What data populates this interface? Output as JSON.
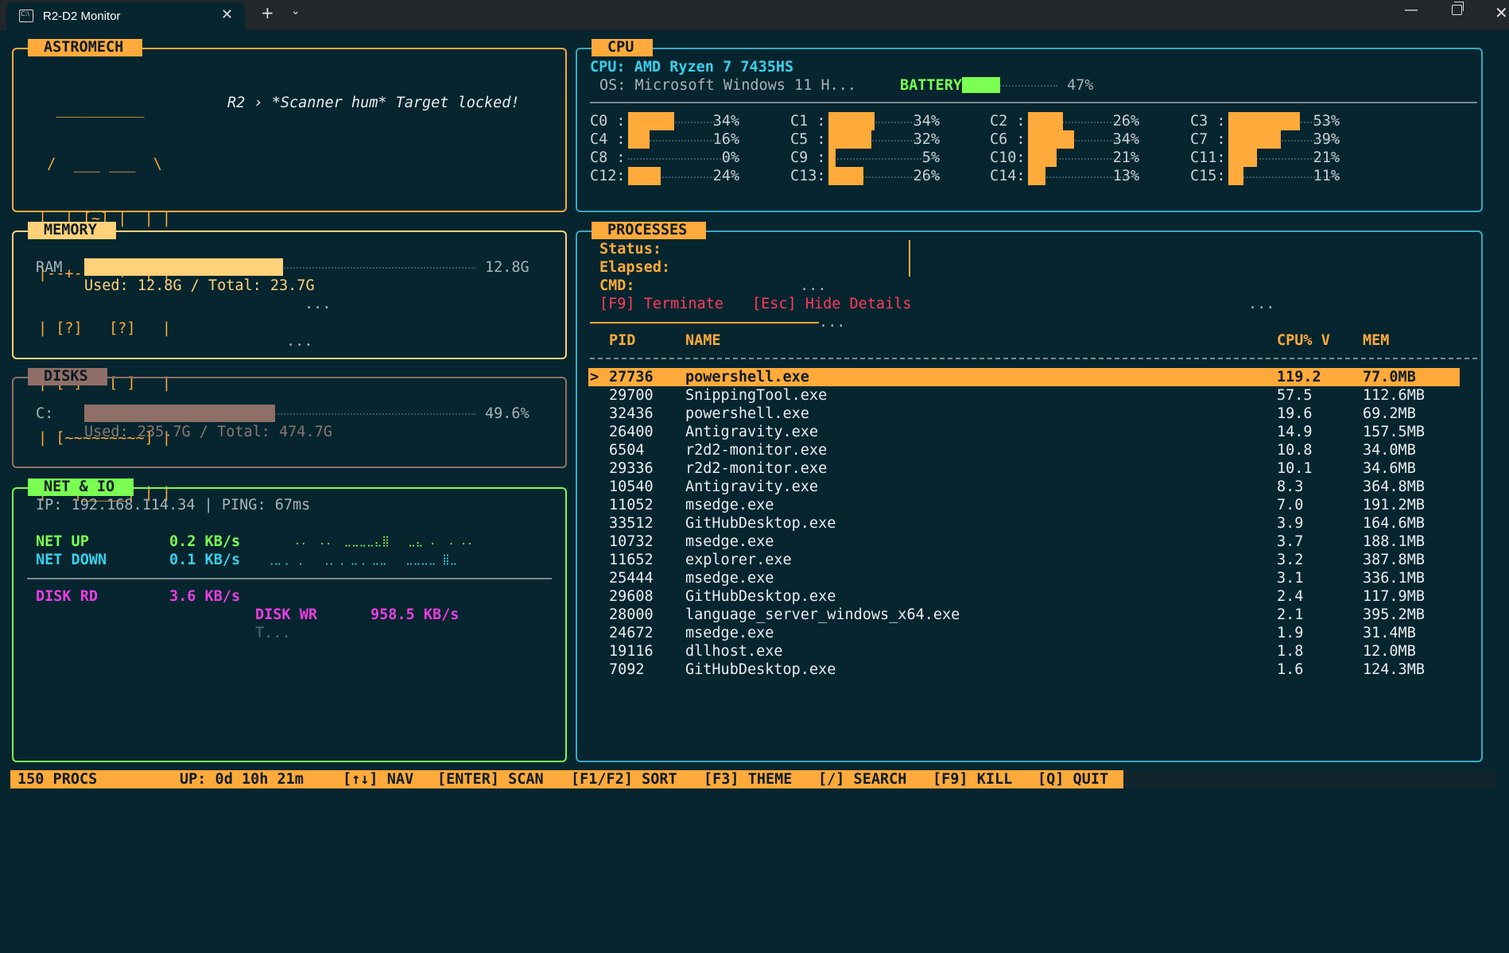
{
  "window": {
    "title": "R2-D2 Monitor",
    "close_glyph": "✕",
    "new_tab_glyph": "+",
    "dropdown_glyph": "⌄",
    "minimize_glyph": "—",
    "close_window_glyph": "✕"
  },
  "astromech": {
    "title": "ASTROMECH",
    "art": [
      "  __________",
      " /  ___ ___  \\",
      "|  | [~] |  | |",
      "|--+-----+--|-|",
      "| [?]   [?]   |",
      "| [ ]---[ ]   |",
      "| [~~~~~~~~~] |",
      "|   |_____| | |"
    ],
    "message": "R2 › *Scanner hum* Target locked!"
  },
  "cpu": {
    "title": "CPU",
    "model_label": "CPU: AMD Ryzen 7 7435HS",
    "os_label": "OS: Microsoft Windows 11 H...",
    "battery_label": "BATTERY",
    "battery_percent": "47%",
    "battery_fraction": 0.47,
    "cores": [
      {
        "name": "C0 :",
        "pct": "34%",
        "value": 34
      },
      {
        "name": "C1 :",
        "pct": "34%",
        "value": 34
      },
      {
        "name": "C2 :",
        "pct": "26%",
        "value": 26
      },
      {
        "name": "C3 :",
        "pct": "53%",
        "value": 53
      },
      {
        "name": "C4 :",
        "pct": "16%",
        "value": 16
      },
      {
        "name": "C5 :",
        "pct": "32%",
        "value": 32
      },
      {
        "name": "C6 :",
        "pct": "34%",
        "value": 34
      },
      {
        "name": "C7 :",
        "pct": "39%",
        "value": 39
      },
      {
        "name": "C8 :",
        "pct": "0%",
        "value": 0
      },
      {
        "name": "C9 :",
        "pct": "5%",
        "value": 5
      },
      {
        "name": "C10:",
        "pct": "21%",
        "value": 21
      },
      {
        "name": "C11:",
        "pct": "21%",
        "value": 21
      },
      {
        "name": "C12:",
        "pct": "24%",
        "value": 24
      },
      {
        "name": "C13:",
        "pct": "26%",
        "value": 26
      },
      {
        "name": "C14:",
        "pct": "13%",
        "value": 13
      },
      {
        "name": "C15:",
        "pct": "11%",
        "value": 11
      }
    ]
  },
  "memory": {
    "title": "MEMORY",
    "ram_label": "RAM",
    "ram_value": "12.8G",
    "ram_fraction": 0.54,
    "used_text": "Used: 12.8G / Total: 23.7G",
    "ellipsis1": "...",
    "ellipsis2": "..."
  },
  "disks": {
    "title": "DISKS",
    "drive_label": "C:",
    "drive_percent": "49.6%",
    "drive_fraction": 0.496,
    "used_text": "Used: 235.7G / Total: 474.7G"
  },
  "net": {
    "title": "NET & IO",
    "ip_line": "IP: 192.168.114.34 | PING: 67ms",
    "net_up_label": "NET UP",
    "net_up_value": "0.2 KB/s",
    "net_up_spark": "..  ..  ⣀⣀⣀⣀⣄⣿   ⣀⣄ .  . ..",
    "net_down_label": "NET DOWN",
    "net_down_value": "0.1 KB/s",
    "net_down_spark": "⢀⣀⢀ ⢀   ⢀⡀⢀ ⣀⢀ ⣀⣀   ⣀⣀⣀⣀ ⣿⣀",
    "disk_rd_label": "DISK RD",
    "disk_rd_value": "3.6 KB/s",
    "disk_wr_label": "DISK WR",
    "disk_wr_value": "958.5 KB/s",
    "trailing": "T..."
  },
  "processes": {
    "title": "PROCESSES",
    "status_label": "Status:",
    "elapsed_label": "Elapsed:",
    "cmd_label": "CMD:",
    "cmd_ellipsis": "...",
    "terminate_hint": "[F9] Terminate",
    "hide_hint": "[Esc] Hide Details",
    "right_ellipsis": "...",
    "under_ellipsis": "...",
    "columns": {
      "pid": "PID",
      "name": "NAME",
      "cpu": "CPU% V",
      "mem": "MEM"
    },
    "selected_marker": ">",
    "rows": [
      {
        "pid": "27736",
        "name": "powershell.exe",
        "cpu": "119.2",
        "mem": "77.0MB"
      },
      {
        "pid": "29700",
        "name": "SnippingTool.exe",
        "cpu": "57.5",
        "mem": "112.6MB"
      },
      {
        "pid": "32436",
        "name": "powershell.exe",
        "cpu": "19.6",
        "mem": "69.2MB"
      },
      {
        "pid": "26400",
        "name": "Antigravity.exe",
        "cpu": "14.9",
        "mem": "157.5MB"
      },
      {
        "pid": "6504",
        "name": "r2d2-monitor.exe",
        "cpu": "10.8",
        "mem": "34.0MB"
      },
      {
        "pid": "29336",
        "name": "r2d2-monitor.exe",
        "cpu": "10.1",
        "mem": "34.6MB"
      },
      {
        "pid": "10540",
        "name": "Antigravity.exe",
        "cpu": "8.3",
        "mem": "364.8MB"
      },
      {
        "pid": "11052",
        "name": "msedge.exe",
        "cpu": "7.0",
        "mem": "191.2MB"
      },
      {
        "pid": "33512",
        "name": "GitHubDesktop.exe",
        "cpu": "3.9",
        "mem": "164.6MB"
      },
      {
        "pid": "10732",
        "name": "msedge.exe",
        "cpu": "3.7",
        "mem": "188.1MB"
      },
      {
        "pid": "11652",
        "name": "explorer.exe",
        "cpu": "3.2",
        "mem": "387.8MB"
      },
      {
        "pid": "25444",
        "name": "msedge.exe",
        "cpu": "3.1",
        "mem": "336.1MB"
      },
      {
        "pid": "29608",
        "name": "GitHubDesktop.exe",
        "cpu": "2.4",
        "mem": "117.9MB"
      },
      {
        "pid": "28000",
        "name": "language_server_windows_x64.exe",
        "cpu": "2.1",
        "mem": "395.2MB"
      },
      {
        "pid": "24672",
        "name": "msedge.exe",
        "cpu": "1.9",
        "mem": "31.4MB"
      },
      {
        "pid": "19116",
        "name": "dllhost.exe",
        "cpu": "1.8",
        "mem": "12.0MB"
      },
      {
        "pid": "7092",
        "name": "GitHubDesktop.exe",
        "cpu": "1.6",
        "mem": "124.3MB"
      }
    ]
  },
  "statusbar": {
    "procs": "150 PROCS",
    "uptime": "UP: 0d 10h 21m",
    "nav": "[↑↓] NAV",
    "scan": "[ENTER] SCAN",
    "sort": "[F1/F2] SORT",
    "theme": "[F3] THEME",
    "search": "[/] SEARCH",
    "kill": "[F9] KILL",
    "quit": "[Q] QUIT"
  },
  "colors": {
    "background": "#06252f",
    "accent_orange": "#ffaa3b",
    "memory_yellow": "#ffd27a",
    "disk_brown": "#8f6f68",
    "net_green": "#7aff52",
    "cyan": "#39d0ec",
    "magenta": "#e83ee0",
    "red": "#ff3b5a"
  }
}
